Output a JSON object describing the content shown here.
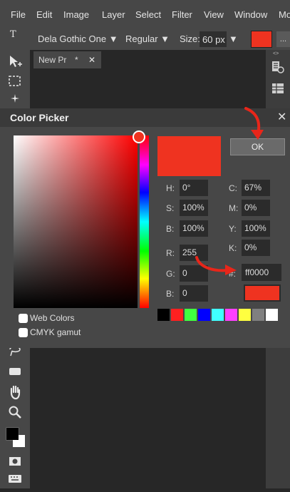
{
  "menu": [
    "File",
    "Edit",
    "Image",
    "Layer",
    "Select",
    "Filter",
    "View",
    "Window",
    "Mo"
  ],
  "options_bar": {
    "font_family": "Dela Gothic One ▼",
    "font_style": "Regular ▼",
    "size_label": "Size:",
    "size_value": "60 px",
    "size_arrow": "▼",
    "more": "...",
    "text_tool_glyph": "T",
    "text_color": "#ef3320"
  },
  "document_tab": {
    "title": "New Pr",
    "dirty": "*",
    "close": "✕"
  },
  "dialog": {
    "title": "Color Picker",
    "close": "✕",
    "ok_label": "OK",
    "fields": {
      "h_label": "H:",
      "h_value": "0°",
      "s_label": "S:",
      "s_value": "100%",
      "b_label": "B:",
      "b_value": "100%",
      "r_label": "R:",
      "r_value": "255",
      "g_label": "G:",
      "g_value": "0",
      "b2_label": "B:",
      "b2_value": "0",
      "c_label": "C:",
      "c_value": "67%",
      "m_label": "M:",
      "m_value": "0%",
      "y_label": "Y:",
      "y_value": "100%",
      "k_label": "K:",
      "k_value": "0%",
      "hex_label": "#:",
      "hex_value": "ff0000"
    },
    "web_colors_label": "Web Colors",
    "cmyk_gamut_label": "CMYK gamut",
    "selected_color": "#ef3320",
    "palette": [
      "#000000",
      "#ff2020",
      "#40ff40",
      "#0000ff",
      "#40ffff",
      "#ff40ff",
      "#ffff40",
      "#808080",
      "#ffffff"
    ]
  },
  "icons": [
    "move-tool-icon",
    "marquee-tool-icon",
    "magic-wand-icon",
    "lasso-tool-icon",
    "shape-tool-icon",
    "hand-tool-icon",
    "zoom-tool-icon",
    "color-swatches-icon",
    "quick-mask-icon",
    "keyboard-icon",
    "history-panel-icon",
    "layers-panel-icon"
  ]
}
